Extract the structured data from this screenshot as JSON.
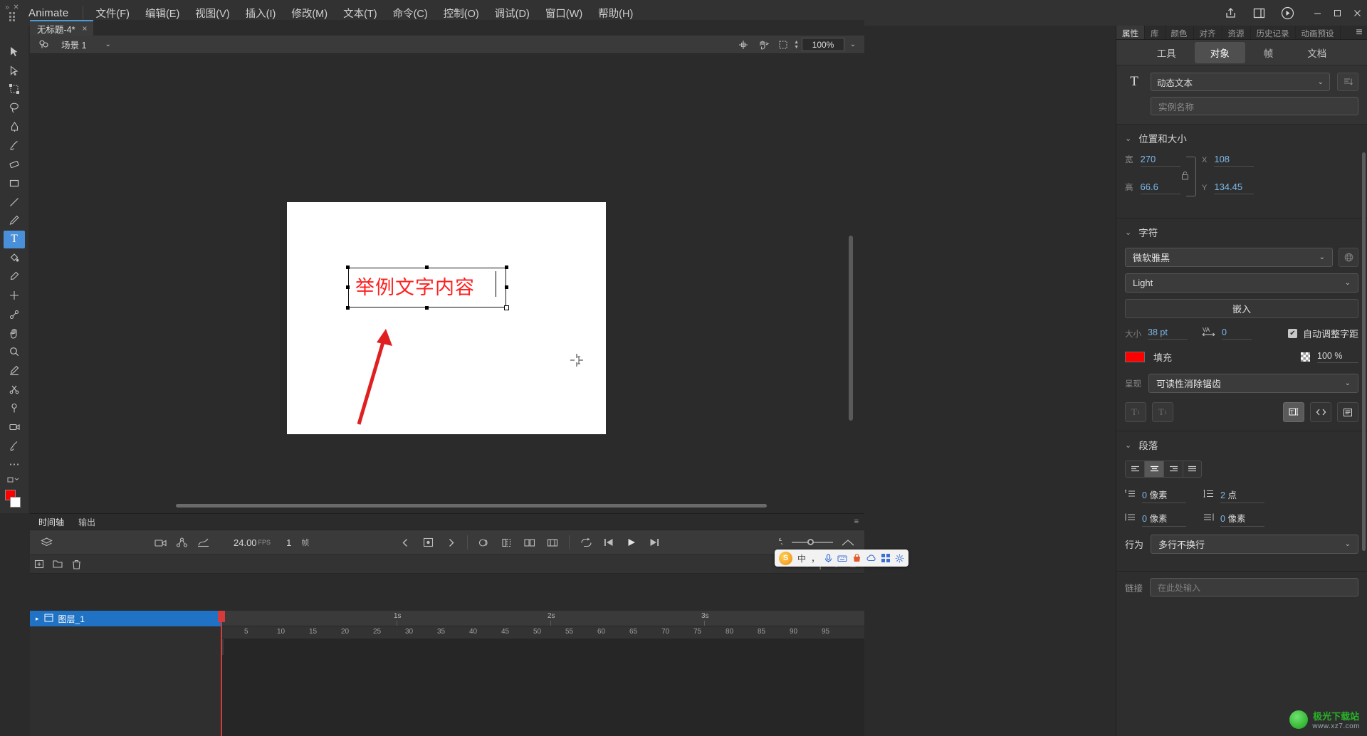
{
  "app": {
    "name": "Animate"
  },
  "menu": {
    "items": [
      "文件(F)",
      "编辑(E)",
      "视图(V)",
      "插入(I)",
      "修改(M)",
      "文本(T)",
      "命令(C)",
      "控制(O)",
      "调试(D)",
      "窗口(W)",
      "帮助(H)"
    ],
    "right_icons": [
      "share-icon",
      "workspace-icon",
      "play-icon"
    ],
    "window_buttons": [
      "minimize",
      "maximize",
      "close"
    ]
  },
  "document_tab": {
    "title": "无标题-4*",
    "close": "×"
  },
  "toolbar": {
    "tools": [
      {
        "name": "selection-tool",
        "glyph": "▶"
      },
      {
        "name": "subselection-tool",
        "glyph": "▷"
      },
      {
        "name": "free-transform-tool",
        "glyph": "⬚"
      },
      {
        "name": "lasso-tool",
        "glyph": "◌"
      },
      {
        "name": "pen-tool",
        "glyph": "✒"
      },
      {
        "name": "brush-tool",
        "glyph": "🖌"
      },
      {
        "name": "eraser-tool",
        "glyph": "◧"
      },
      {
        "name": "rectangle-tool",
        "glyph": "▭"
      },
      {
        "name": "line-tool",
        "glyph": "／"
      },
      {
        "name": "pencil-tool",
        "glyph": "✏"
      },
      {
        "name": "text-tool",
        "glyph": "T"
      },
      {
        "name": "paint-bucket-tool",
        "glyph": "🪣"
      },
      {
        "name": "eyedropper-tool",
        "glyph": "💉"
      },
      {
        "name": "width-tool",
        "glyph": "✛"
      },
      {
        "name": "bone-tool",
        "glyph": "🦴"
      },
      {
        "name": "hand-tool",
        "glyph": "✋"
      },
      {
        "name": "zoom-tool",
        "glyph": "🔍"
      },
      {
        "name": "ink-bottle-tool",
        "glyph": "🖊"
      },
      {
        "name": "bind-tool",
        "glyph": "✂"
      },
      {
        "name": "asset-warp-tool",
        "glyph": "📌"
      },
      {
        "name": "camera-tool",
        "glyph": "🎥"
      },
      {
        "name": "paint-brush-tool",
        "glyph": "🖍"
      },
      {
        "name": "more-tools",
        "glyph": "⋯"
      }
    ],
    "stroke_color": "#ff0000",
    "fill_color": "#ffffff"
  },
  "stage": {
    "scene_label": "场景 1",
    "zoom": "100%",
    "toolbar_icons": [
      "center-stage-icon",
      "rotate-icon",
      "clip-icon"
    ],
    "text_object": {
      "content": "举例文字内容",
      "color": "#ff2020"
    }
  },
  "timeline": {
    "tabs": [
      "时间轴",
      "输出"
    ],
    "active_tab": "时间轴",
    "fps": "24.00",
    "fps_unit": "FPS",
    "current_frame": "1",
    "frame_unit": "帧",
    "layer": {
      "name": "图层_1"
    },
    "ruler_marks": [
      "1s",
      "2s",
      "3s"
    ],
    "frame_numbers": [
      "5",
      "10",
      "15",
      "20",
      "25",
      "30",
      "35",
      "40",
      "45",
      "50",
      "55",
      "60",
      "65",
      "70",
      "75",
      "80",
      "85",
      "90",
      "95"
    ]
  },
  "properties": {
    "panel_tabs": [
      "属性",
      "库",
      "颜色",
      "对齐",
      "资源",
      "历史记录",
      "动画预设"
    ],
    "active_panel_tab": "属性",
    "sub_tabs": [
      "工具",
      "对象",
      "帧",
      "文档"
    ],
    "active_sub_tab": "对象",
    "object": {
      "type_icon": "T",
      "text_type": "动态文本",
      "instance_name_placeholder": "实例名称"
    },
    "position_size": {
      "title": "位置和大小",
      "w_label": "宽",
      "w_value": "270",
      "h_label": "高",
      "h_value": "66.6",
      "x_label": "X",
      "x_value": "108",
      "y_label": "Y",
      "y_value": "134.45",
      "lock_icon": "unlocked-lock-icon"
    },
    "character": {
      "title": "字符",
      "font_family": "微软雅黑",
      "font_style": "Light",
      "embed_button": "嵌入",
      "size_label": "大小",
      "size_value": "38 pt",
      "tracking_icon": "VA",
      "tracking_value": "0",
      "auto_kern_label": "自动调整字距",
      "auto_kern_checked": true,
      "fill_label": "填充",
      "fill_color": "#ff0000",
      "alpha_value": "100 %",
      "render_label": "呈现",
      "render_value": "可读性消除锯齿",
      "buttons": [
        "subscript-button",
        "superscript-button",
        "selectable-text-button",
        "render-as-html-button",
        "show-border-button"
      ]
    },
    "paragraph": {
      "title": "段落",
      "align_options": [
        "align-left",
        "align-center",
        "align-right",
        "align-justify"
      ],
      "align_active": 1,
      "indent_value": "0",
      "indent_unit": "像素",
      "line_spacing_value": "2",
      "line_spacing_unit": "点",
      "margin_left_value": "0",
      "margin_left_unit": "像素",
      "margin_right_value": "0",
      "margin_right_unit": "像素"
    },
    "options": {
      "behavior_label": "行为",
      "behavior_value": "多行不换行",
      "link_label": "链接",
      "link_placeholder": "在此处输入"
    }
  },
  "ime": {
    "logo": "S",
    "items": [
      "中",
      "，"
    ],
    "icons": [
      "mic-icon",
      "keyboard-icon",
      "bag-icon",
      "cloud-icon",
      "grid-icon",
      "gear-icon"
    ]
  },
  "watermark": {
    "line1": "极光下载站",
    "line2": "www.xz7.com"
  }
}
